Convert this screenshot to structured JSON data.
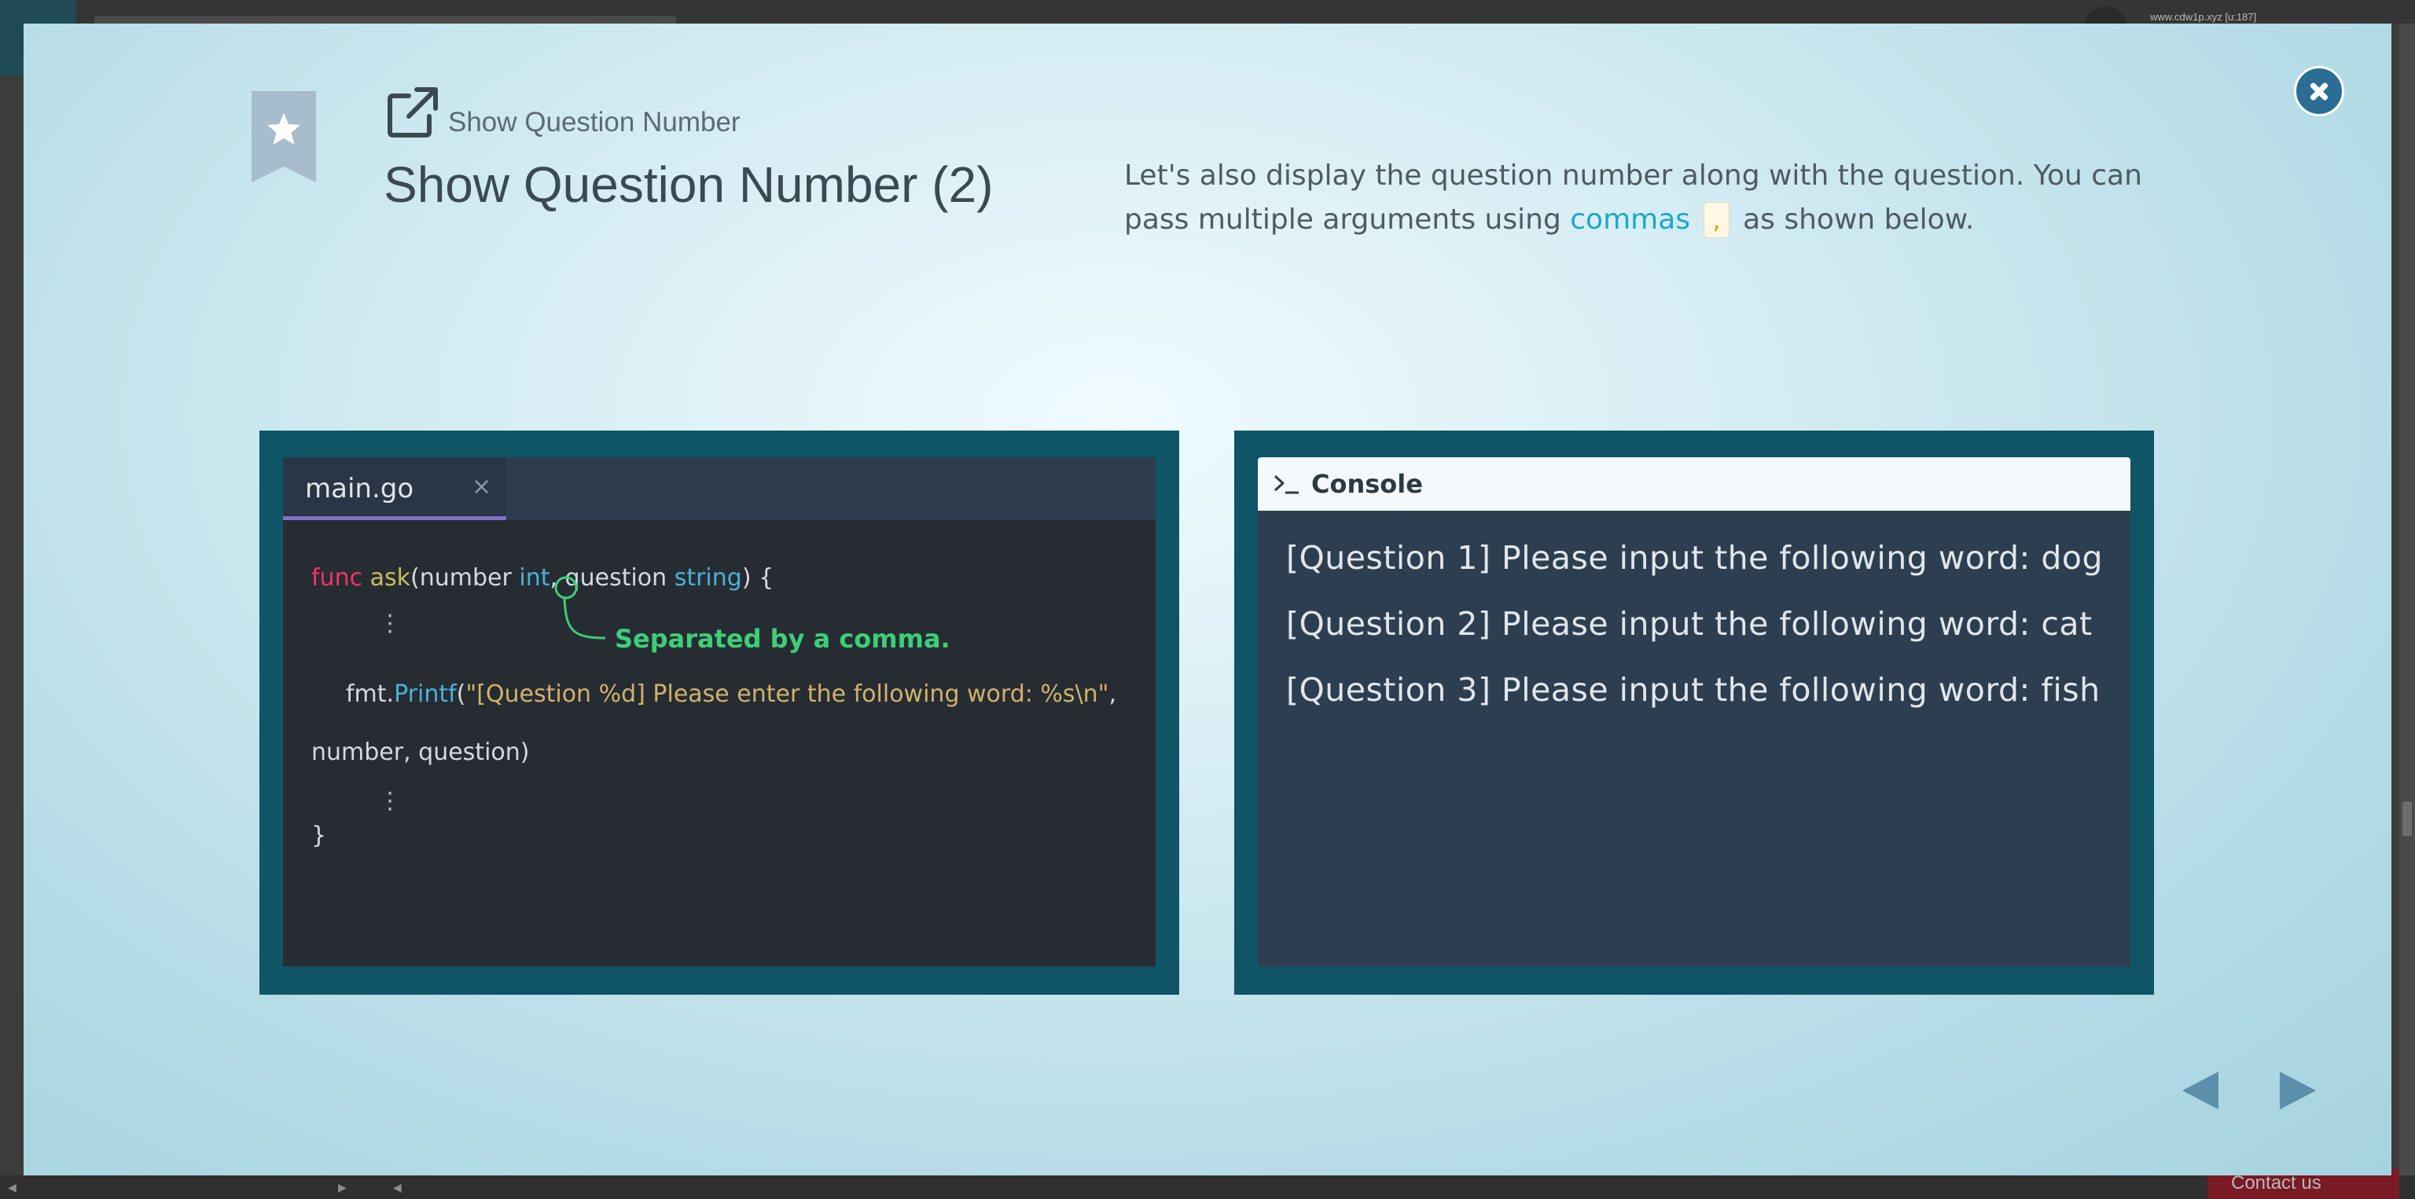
{
  "background": {
    "user_email": "www.cdw1p.xyz [u:187]",
    "contact_label": "Contact us"
  },
  "header": {
    "subtitle": "Show Question Number",
    "title": "Show Question Number (2)"
  },
  "description": {
    "text_before": "Let's also display the question number along with the question. You can pass multiple arguments using ",
    "link": "commas",
    "code": ",",
    "text_after": " as shown below."
  },
  "editor": {
    "tab_name": "main.go",
    "tab_close": "×",
    "line1": {
      "kw": "func",
      "fn": "ask",
      "p1": "(number ",
      "t1": "int",
      "p2": ", question ",
      "t2": "string",
      "p3": ") {"
    },
    "line2": {
      "obj": "fmt.",
      "method": "Printf",
      "open": "(",
      "str": "\"[Question %d] Please enter the following word: %s\\n\"",
      "comma": ","
    },
    "line3": "number, question)",
    "closing_brace": "}",
    "annotation": "Separated by a comma."
  },
  "console": {
    "title": "Console",
    "lines": [
      "[Question 1] Please input the following word: dog",
      "[Question 2] Please input the following word: cat",
      "[Question 3] Please input the following word: fish"
    ]
  },
  "colors": {
    "close_button": "#2c6e93",
    "panel": "#0f5566",
    "editor_bg": "#272c33",
    "console_bg": "#2c3e50",
    "keyword": "#f0346b",
    "type": "#48b2d8",
    "string": "#d0b26a",
    "annotation": "#3ccf7a",
    "link": "#1ba8c8"
  },
  "icons": {
    "bookmark": "bookmark-star-icon",
    "external_link": "external-link-icon",
    "close": "close-icon",
    "prompt": "terminal-prompt-icon",
    "prev": "triangle-left-icon",
    "next": "triangle-right-icon"
  }
}
